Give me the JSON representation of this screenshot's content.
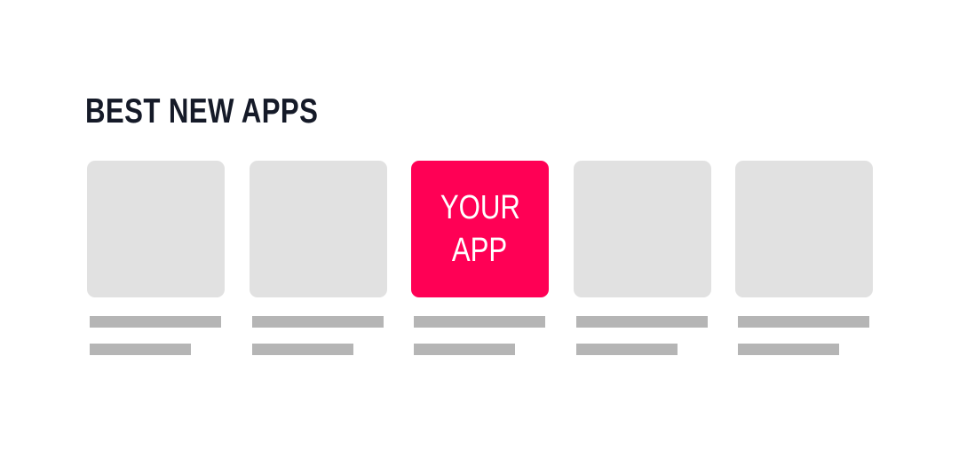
{
  "section": {
    "title": "BEST NEW APPS"
  },
  "colors": {
    "highlight": "#ff0055",
    "placeholder_tile": "#e1e1e1",
    "placeholder_text": "#b5b5b5",
    "title": "#151a28"
  },
  "cards": [
    {
      "highlighted": false
    },
    {
      "highlighted": false
    },
    {
      "highlighted": true,
      "line1": "YOUR",
      "line2": "APP"
    },
    {
      "highlighted": false
    },
    {
      "highlighted": false
    }
  ]
}
